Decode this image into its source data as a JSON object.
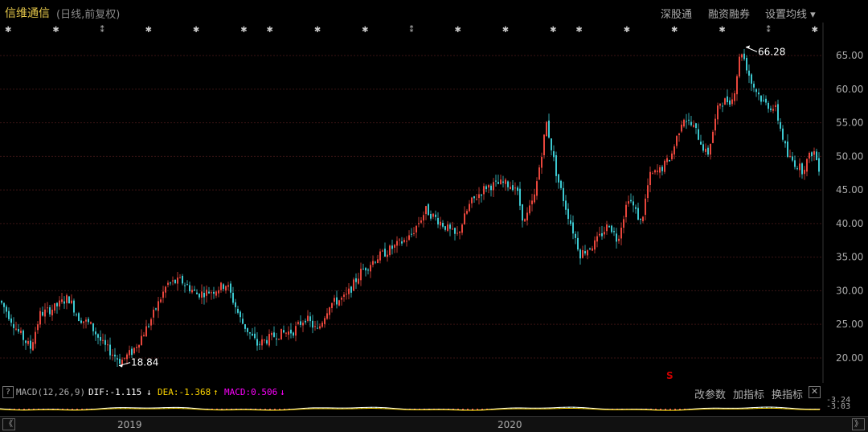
{
  "header": {
    "stock_name": "信维通信",
    "adjust_mode": "(日线,前复权)",
    "btn_sz_connect": "深股通",
    "btn_margin": "融资融券",
    "btn_ma": "设置均线",
    "btn_ma_arrow": "▾"
  },
  "macd_bar": {
    "help": "?",
    "indicator": "MACD(12,26,9)",
    "dif": "DIF:-1.115",
    "dif_arrow": "↓",
    "dea": "DEA:-1.368",
    "dea_arrow": "↑",
    "macd": "MACD:0.506",
    "macd_arrow": "↓",
    "btn_params": "改参数",
    "btn_add": "加指标",
    "btn_switch": "换指标",
    "close": "✕",
    "right_top": "-3.24",
    "right_bottom": "-3.03"
  },
  "scrollbar": {
    "left_arrow": "《",
    "right_arrow": "》",
    "years": [
      {
        "label": "2019",
        "at": 0.147
      },
      {
        "label": "2020",
        "at": 0.585
      }
    ]
  },
  "colors": {
    "up": "#e8463c",
    "down": "#3cc8d0",
    "grid": "#3a1414",
    "axis_text": "#aaaaaa",
    "title": "#e6c84a",
    "dif": "#ffffff",
    "dea": "#ffd700",
    "macd": "#ff00ff",
    "marker": "#cc0000"
  },
  "chart_data": {
    "type": "candlestick",
    "title": "信维通信",
    "ylim": [
      17,
      68
    ],
    "yticks": [
      20,
      25,
      30,
      35,
      40,
      45,
      50,
      55,
      60,
      65
    ],
    "ytick_labels": [
      "20.00",
      "25.00",
      "30.00",
      "35.00",
      "40.00",
      "45.00",
      "50.00",
      "55.00",
      "60.00",
      "65.00"
    ],
    "x_start": "2018-10",
    "x_end": "2020-08",
    "close_path": [
      [
        0,
        28.5
      ],
      [
        8,
        27
      ],
      [
        22,
        24
      ],
      [
        38,
        21.5
      ],
      [
        50,
        26.5
      ],
      [
        68,
        27.5
      ],
      [
        85,
        29
      ],
      [
        98,
        26
      ],
      [
        112,
        25
      ],
      [
        128,
        22
      ],
      [
        150,
        19.5
      ],
      [
        165,
        21
      ],
      [
        185,
        25
      ],
      [
        208,
        31
      ],
      [
        225,
        31.5
      ],
      [
        245,
        29.5
      ],
      [
        265,
        30
      ],
      [
        282,
        31
      ],
      [
        300,
        25.5
      ],
      [
        320,
        22
      ],
      [
        345,
        23.5
      ],
      [
        365,
        24
      ],
      [
        380,
        26
      ],
      [
        395,
        24
      ],
      [
        410,
        28
      ],
      [
        430,
        29
      ],
      [
        450,
        33
      ],
      [
        470,
        35
      ],
      [
        490,
        36.5
      ],
      [
        510,
        38
      ],
      [
        530,
        42
      ],
      [
        550,
        40
      ],
      [
        568,
        38
      ],
      [
        585,
        43
      ],
      [
        605,
        45.5
      ],
      [
        625,
        46
      ],
      [
        642,
        45.5
      ],
      [
        652,
        40
      ],
      [
        665,
        44
      ],
      [
        680,
        55
      ],
      [
        693,
        47
      ],
      [
        705,
        42
      ],
      [
        722,
        35.5
      ],
      [
        740,
        37
      ],
      [
        758,
        40
      ],
      [
        768,
        37.5
      ],
      [
        782,
        44
      ],
      [
        798,
        40
      ],
      [
        808,
        47
      ],
      [
        822,
        48
      ],
      [
        835,
        50
      ],
      [
        850,
        56
      ],
      [
        865,
        54
      ],
      [
        880,
        50
      ],
      [
        895,
        58
      ],
      [
        912,
        58.5
      ],
      [
        922,
        66
      ],
      [
        935,
        61
      ],
      [
        950,
        58
      ],
      [
        965,
        57
      ],
      [
        980,
        50
      ],
      [
        998,
        48
      ],
      [
        1012,
        51
      ],
      [
        1020,
        48
      ]
    ],
    "annotations": [
      {
        "label": "66.28",
        "value": 66.28,
        "type": "high"
      },
      {
        "label": "18.84",
        "value": 18.84,
        "type": "low"
      }
    ],
    "event_markers": "✱ ✱ ⁑ ✱ ✱ ✱✱ ✱ ✱ ⁑ ✱ ✱ ✱✱ ✱ ✱ ✱ ⁑ ✱",
    "special_marker": "S"
  }
}
